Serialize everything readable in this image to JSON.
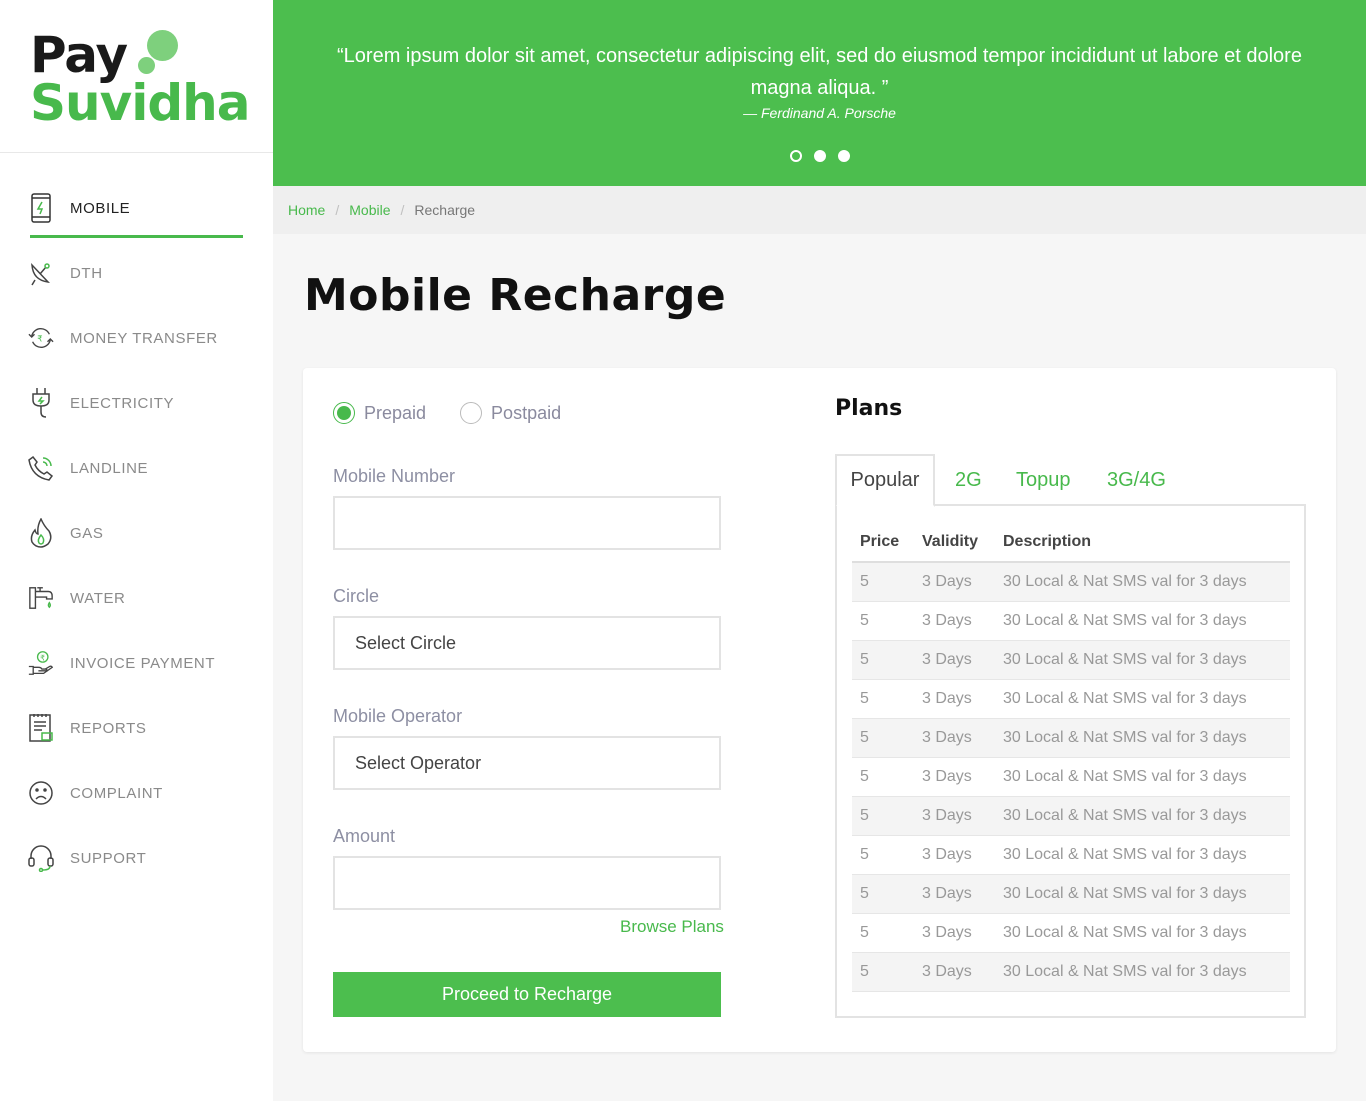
{
  "brand": {
    "line1": "Pay",
    "line2": "Suvidha"
  },
  "nav": {
    "items": [
      {
        "label": "MOBILE",
        "icon": "mobile-icon",
        "active": true
      },
      {
        "label": "DTH",
        "icon": "satellite-dish-icon"
      },
      {
        "label": "MONEY TRANSFER",
        "icon": "money-transfer-icon"
      },
      {
        "label": "ELECTRICITY",
        "icon": "plug-icon"
      },
      {
        "label": "LANDLINE",
        "icon": "phone-icon"
      },
      {
        "label": "GAS",
        "icon": "flame-icon"
      },
      {
        "label": "WATER",
        "icon": "water-tap-icon"
      },
      {
        "label": "INVOICE PAYMENT",
        "icon": "invoice-payment-icon"
      },
      {
        "label": "REPORTS",
        "icon": "report-icon"
      },
      {
        "label": "COMPLAINT",
        "icon": "sad-face-icon"
      },
      {
        "label": "SUPPORT",
        "icon": "headset-icon"
      }
    ]
  },
  "hero": {
    "quote": "“Lorem ipsum dolor sit amet, consectetur adipiscing elit, sed do eiusmod tempor incididunt ut labore et dolore magna aliqua. ”",
    "author": "— Ferdinand A. Porsche",
    "slides": 3,
    "active_slide": 1
  },
  "breadcrumb": {
    "home": "Home",
    "mobile": "Mobile",
    "current": "Recharge",
    "separator": "/"
  },
  "page": {
    "title": "Mobile Recharge"
  },
  "form": {
    "type_options": [
      "Prepaid",
      "Postpaid"
    ],
    "selected_type": "Prepaid",
    "mobile_label": "Mobile Number",
    "mobile_value": "",
    "circle_label": "Circle",
    "circle_value": "Select Circle",
    "operator_label": "Mobile Operator",
    "operator_value": "Select Operator",
    "amount_label": "Amount",
    "amount_value": "",
    "browse_plans": "Browse Plans",
    "submit": "Proceed to Recharge"
  },
  "plans": {
    "title": "Plans",
    "tabs": [
      "Popular",
      "2G",
      "Topup",
      "3G/4G"
    ],
    "active_tab": "Popular",
    "columns": [
      "Price",
      "Validity",
      "Description"
    ],
    "rows": [
      [
        "5",
        "3 Days",
        "30 Local & Nat SMS val for 3 days"
      ],
      [
        "5",
        "3 Days",
        "30 Local & Nat SMS val for 3 days"
      ],
      [
        "5",
        "3 Days",
        "30 Local & Nat SMS val for 3 days"
      ],
      [
        "5",
        "3 Days",
        "30 Local & Nat SMS val for 3 days"
      ],
      [
        "5",
        "3 Days",
        "30 Local & Nat SMS val for 3 days"
      ],
      [
        "5",
        "3 Days",
        "30 Local & Nat SMS val for 3 days"
      ],
      [
        "5",
        "3 Days",
        "30 Local & Nat SMS val for 3 days"
      ],
      [
        "5",
        "3 Days",
        "30 Local & Nat SMS val for 3 days"
      ],
      [
        "5",
        "3 Days",
        "30 Local & Nat SMS val for 3 days"
      ],
      [
        "5",
        "3 Days",
        "30 Local & Nat SMS val for 3 days"
      ],
      [
        "5",
        "3 Days",
        "30 Local & Nat SMS val for 3 days"
      ]
    ]
  },
  "colors": {
    "accent": "#4cbe4e",
    "logo_dot": "#7ed07d",
    "dark": "#1a1a1a"
  }
}
